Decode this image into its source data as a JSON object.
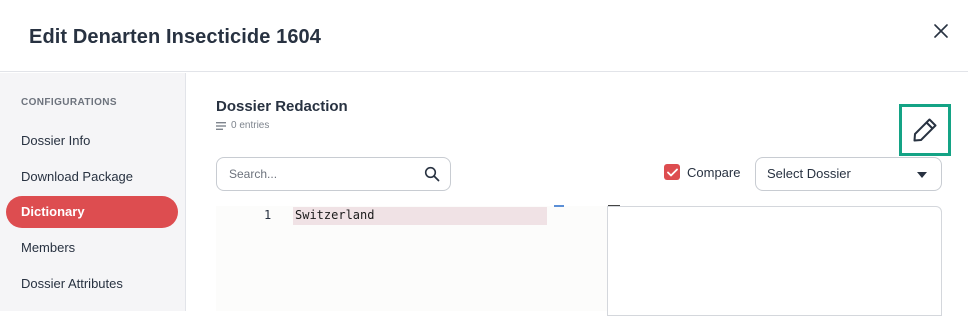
{
  "modal": {
    "title": "Edit Denarten Insecticide 1604",
    "close_icon": "close-icon"
  },
  "sidebar": {
    "heading": "CONFIGURATIONS",
    "items": [
      {
        "label": "Dossier Info",
        "active": false
      },
      {
        "label": "Download Package",
        "active": false
      },
      {
        "label": "Dictionary",
        "active": true
      },
      {
        "label": "Members",
        "active": false
      },
      {
        "label": "Dossier Attributes",
        "active": false
      }
    ]
  },
  "main": {
    "title": "Dossier Redaction",
    "entries": "0 entries",
    "search": {
      "placeholder": "Search...",
      "value": ""
    },
    "compare": {
      "label": "Compare",
      "checked": true
    },
    "select": {
      "value": "Select Dossier"
    },
    "editor": {
      "lines": [
        {
          "number": "1",
          "text": "Switzerland"
        }
      ]
    }
  },
  "colors": {
    "accent": "#dd4d50",
    "highlight_border": "#14a385",
    "text": "#283241"
  }
}
